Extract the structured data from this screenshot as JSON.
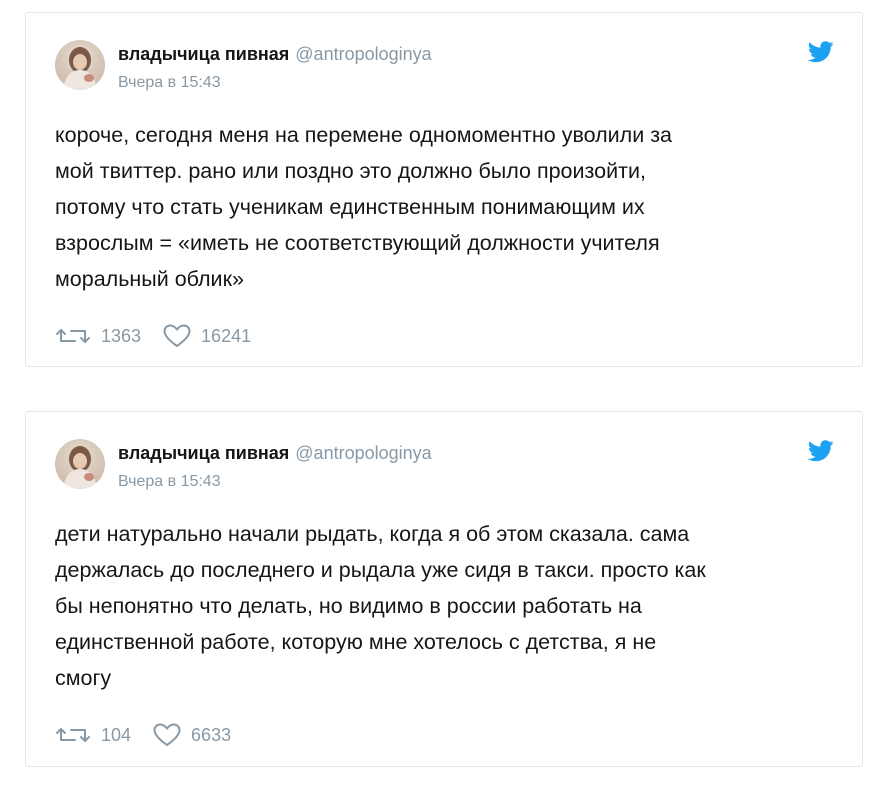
{
  "tweets": [
    {
      "author": {
        "display_name": "владычица пивная",
        "handle": "@antropologinya",
        "avatar_icon": "user-avatar"
      },
      "timestamp": "Вчера в 15:43",
      "text": "короче, сегодня меня на перемене одномоментно уволили за\nмой твиттер. рано или поздно это должно было произойти,\nпотому что стать ученикам единственным понимающим их\nвзрослым = «иметь не соответствующий должности учителя\nморальный облик»",
      "retweets": "1363",
      "likes": "16241",
      "icons": [
        "twitter-bird-icon",
        "retweet-icon",
        "heart-icon"
      ]
    },
    {
      "author": {
        "display_name": "владычица пивная",
        "handle": "@antropologinya",
        "avatar_icon": "user-avatar"
      },
      "timestamp": "Вчера в 15:43",
      "text": "дети натурально начали рыдать, когда я об этом сказала. сама\nдержалась до последнего и рыдала уже сидя в такси. просто как\nбы непонятно что делать, но видимо в россии работать на\nединственной работе, которую мне хотелось с детства, я не\nсмогу",
      "retweets": "104",
      "likes": "6633",
      "icons": [
        "twitter-bird-icon",
        "retweet-icon",
        "heart-icon"
      ]
    }
  ],
  "colors": {
    "twitter_blue": "#1da1f2",
    "text_primary": "#14171a",
    "text_secondary": "#8899a6",
    "card_border": "#e1e8ed"
  }
}
